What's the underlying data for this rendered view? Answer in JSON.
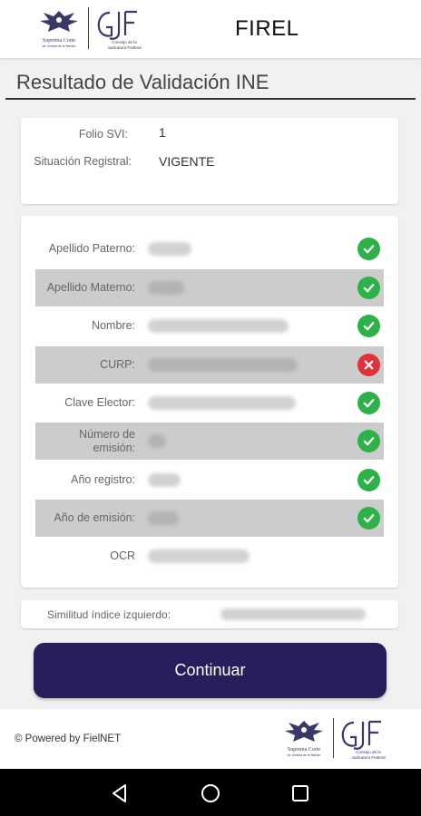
{
  "header": {
    "app_title": "FIREL",
    "logo_scjn_text": [
      "Suprema Corte",
      "de Justicia de la Nación"
    ],
    "logo_cjf_text": [
      "Consejo de la",
      "Judicatura Federal"
    ]
  },
  "page": {
    "title": "Resultado de Validación INE"
  },
  "registro": {
    "folio_label": "Folio SVI:",
    "folio_value": "1",
    "situacion_label": "Situación Registral:",
    "situacion_value": "VIGENTE"
  },
  "validation_rows": [
    {
      "label": "Apellido Paterno:",
      "status": "ok",
      "shaded": false,
      "value_redacted": true
    },
    {
      "label": "Apellido Materno:",
      "status": "ok",
      "shaded": true,
      "value_redacted": true
    },
    {
      "label": "Nombre:",
      "status": "ok",
      "shaded": false,
      "value_redacted": true
    },
    {
      "label": "CURP:",
      "status": "error",
      "shaded": true,
      "value_redacted": true
    },
    {
      "label": "Clave Elector:",
      "status": "ok",
      "shaded": false,
      "value_redacted": true
    },
    {
      "label": "Número de emisión:",
      "status": "ok",
      "shaded": true,
      "value_redacted": true
    },
    {
      "label": "Año registro:",
      "status": "ok",
      "shaded": false,
      "value_redacted": true
    },
    {
      "label": "Año de emisión:",
      "status": "ok",
      "shaded": true,
      "value_redacted": true
    },
    {
      "label": "OCR",
      "status": "none",
      "shaded": false,
      "value_redacted": true
    }
  ],
  "similitud": {
    "label": "Similitud índice izquierdo:",
    "value_redacted": true
  },
  "actions": {
    "continuar_label": "Continuar"
  },
  "footer": {
    "powered_by": "© Powered by FielNET"
  },
  "icons": {
    "ok": "check-circle-icon",
    "error": "x-circle-icon",
    "nav_back": "triangle-back-icon",
    "nav_home": "circle-home-icon",
    "nav_recents": "square-recents-icon"
  },
  "colors": {
    "primary_button": "#271e5c",
    "ok": "#2fb14a",
    "error": "#e0323a",
    "shaded_row": "#cccccc"
  }
}
